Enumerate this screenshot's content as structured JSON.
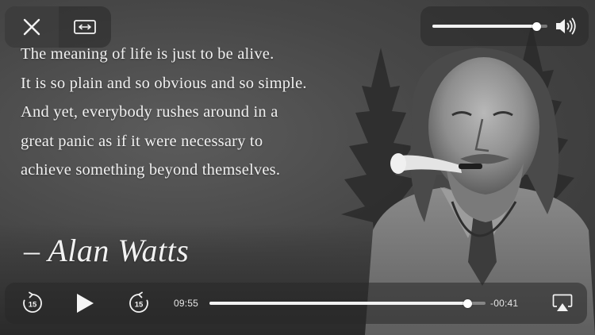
{
  "quote": {
    "lines": [
      "The meaning of life is just to be alive.",
      "It is so plain and so obvious and so simple.",
      "And yet, everybody rushes around in a",
      "great panic as if it were necessary to",
      "achieve something beyond themselves."
    ],
    "author": "– Alan Watts"
  },
  "controls": {
    "close_icon": "close-icon",
    "zoom_icon": "aspect-ratio-icon",
    "volume_icon": "speaker-icon",
    "skip_back_icon": "skip-back-15-icon",
    "play_icon": "play-icon",
    "skip_forward_icon": "skip-forward-15-icon",
    "airplay_icon": "airplay-icon",
    "skip_back_seconds": "15",
    "skip_forward_seconds": "15"
  },
  "volume": {
    "level": 0.9
  },
  "playback": {
    "elapsed": "09:55",
    "remaining": "-00:41",
    "progress": 0.935
  }
}
